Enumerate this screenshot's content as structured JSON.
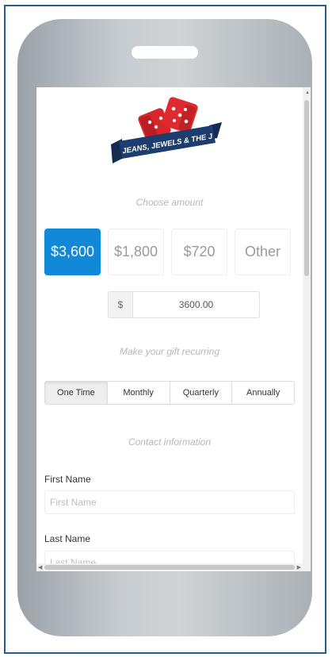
{
  "logo": {
    "text": "JEANS, JEWELS & THE J"
  },
  "sections": {
    "choose_amount": "Choose amount",
    "recurring": "Make your gift recurring",
    "contact": "Contact information"
  },
  "amounts": [
    {
      "label": "$3,600",
      "selected": true
    },
    {
      "label": "$1,800",
      "selected": false
    },
    {
      "label": "$720",
      "selected": false
    },
    {
      "label": "Other",
      "selected": false
    }
  ],
  "amount_input": {
    "currency": "$",
    "value": "3600.00"
  },
  "frequency": [
    {
      "label": "One Time",
      "selected": true
    },
    {
      "label": "Monthly",
      "selected": false
    },
    {
      "label": "Quarterly",
      "selected": false
    },
    {
      "label": "Annually",
      "selected": false
    }
  ],
  "fields": {
    "first_name": {
      "label": "First Name",
      "placeholder": "First Name"
    },
    "last_name": {
      "label": "Last Name",
      "placeholder": "Last Name"
    }
  },
  "colors": {
    "accent": "#1188d8",
    "frame_border": "#1f5d93",
    "phone_body": "#c4c9cd",
    "dice_red": "#d8262b",
    "banner_navy": "#1c3d6e"
  }
}
